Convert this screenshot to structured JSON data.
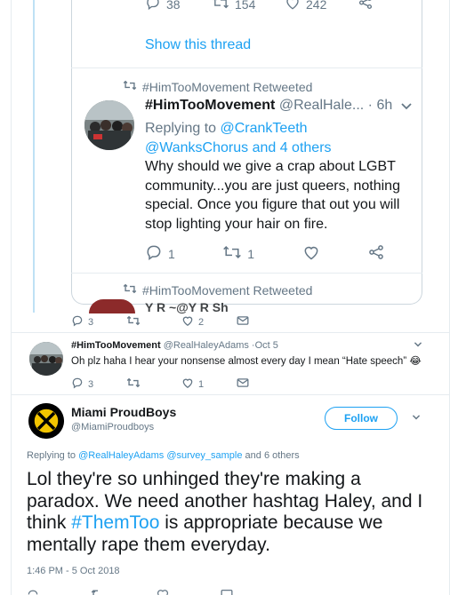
{
  "embed": {
    "top_actions": {
      "replies": "38",
      "retweets": "154",
      "likes": "242"
    },
    "show_thread": "Show this thread",
    "retweet_label": "#HimTooMovement Retweeted",
    "tweet": {
      "name": "#HimTooMovement",
      "handle_time": "@RealHale... · 6h",
      "reply_prefix": "Replying to",
      "reply_user1": "@CrankTeeth",
      "reply_user2": "@WanksChorus and 4 others",
      "body": "Why should we give a crap about LGBT community...you are just queers, nothing special.  Once you figure that out you will stop lighting your hair on fire.",
      "replies": "1",
      "retweets": "1"
    },
    "retweet_label2": "#HimTooMovement Retweeted",
    "partial_name": "Y      R    ~@Y      R          Sh"
  },
  "outer_actions": {
    "replies": "3",
    "likes": "2"
  },
  "tweet2": {
    "name": "#HimTooMovement",
    "handle_time": "@RealHaleyAdams ·Oct 5",
    "body": "Oh plz haha I hear your nonsense almost every day I mean “Hate speech” 😂",
    "replies": "3",
    "likes": "1"
  },
  "proudboys": {
    "name": "Miami ProudBoys",
    "handle": "@MiamiProudboys",
    "follow_label": "Follow",
    "reply_prefix": "Replying to",
    "reply_users": "@RealHaleyAdams @survey_sample",
    "reply_suffix": "and 6 others",
    "body_part1": "Lol they're so unhinged they're making a paradox. We need another hashtag Haley, and I think ",
    "hashtag": "#ThemToo",
    "body_part2": " is appropriate because we mentally rape them everyday.",
    "timestamp": "1:46 PM - 5 Oct 2018"
  },
  "colors": {
    "accent": "#1da1f2",
    "muted": "#657786",
    "text": "#14171a",
    "border": "#e6ecf0"
  }
}
